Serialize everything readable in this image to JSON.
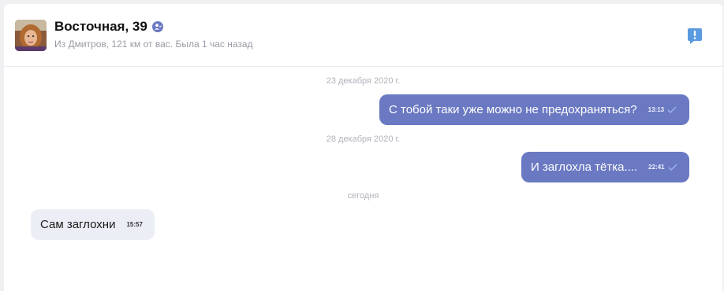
{
  "chat": {
    "contact": {
      "name": "Восточная, 39",
      "status": "Из Дмитров, 121 км от вас. Была 1 час назад",
      "verify_icon": "user-check-icon",
      "report_icon": "exclamation-flag-icon"
    },
    "days": [
      {
        "date": "23 декабря 2020 г.",
        "messages": [
          {
            "direction": "out",
            "text": "С тобой таки уже можно не предохраняться?",
            "time": "13:13",
            "read": true
          }
        ]
      },
      {
        "date": "28 декабря 2020 г.",
        "messages": [
          {
            "direction": "out",
            "text": "И заглохла тётка....",
            "time": "22:41",
            "read": true
          }
        ]
      },
      {
        "date": "сегодня",
        "messages": [
          {
            "direction": "in",
            "text": "Сам заглохни",
            "time": "15:57"
          }
        ]
      }
    ]
  },
  "colors": {
    "outgoing_bubble": "#6a79c2",
    "incoming_bubble": "#eceef5",
    "accent": "#5a7cc9"
  }
}
